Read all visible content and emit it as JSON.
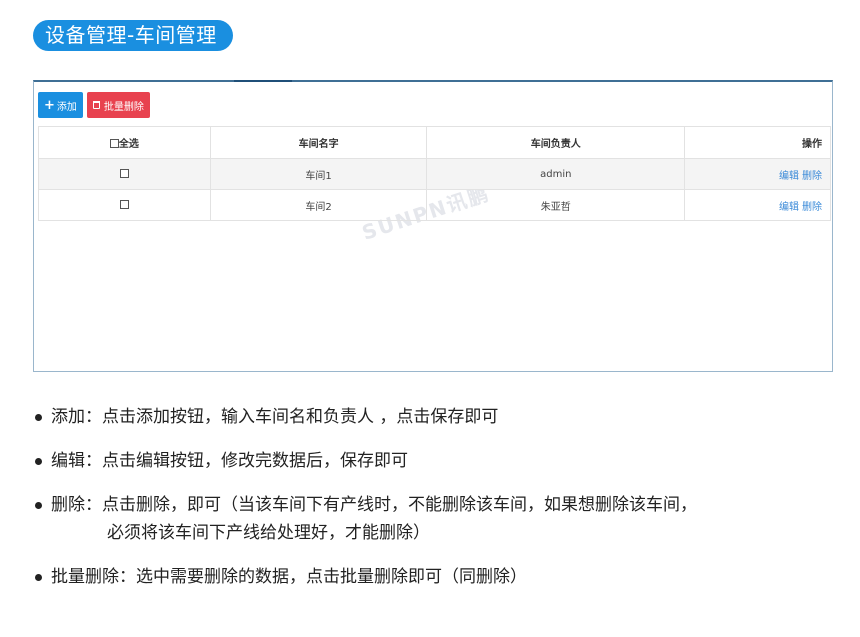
{
  "header": {
    "title": "设备管理-车间管理"
  },
  "toolbar": {
    "add_label": "添加",
    "batch_delete_label": "批量删除"
  },
  "table": {
    "columns": [
      "全选",
      "车间名字",
      "车间负责人",
      "操作"
    ],
    "rows": [
      {
        "name": "车间1",
        "manager": "admin",
        "edit": "编辑",
        "delete": "删除"
      },
      {
        "name": "车间2",
        "manager": "朱亚哲",
        "edit": "编辑",
        "delete": "删除"
      }
    ]
  },
  "watermark": "SUNPN讯鹏",
  "notes": [
    {
      "text": "添加：点击添加按钮，输入车间名和负责人 ，点击保存即可"
    },
    {
      "text": "编辑：点击编辑按钮，修改完数据后，保存即可"
    },
    {
      "text": "删除：点击删除，即可（当该车间下有产线时，不能删除该车间，如果想删除该车间，",
      "cont": "必须将该车间下产线给处理好，才能删除）"
    },
    {
      "text": "批量删除：选中需要删除的数据，点击批量删除即可（同删除）"
    }
  ],
  "colors": {
    "accent": "#1a8fe0",
    "danger": "#e8424f",
    "link": "#3a8ad8"
  }
}
